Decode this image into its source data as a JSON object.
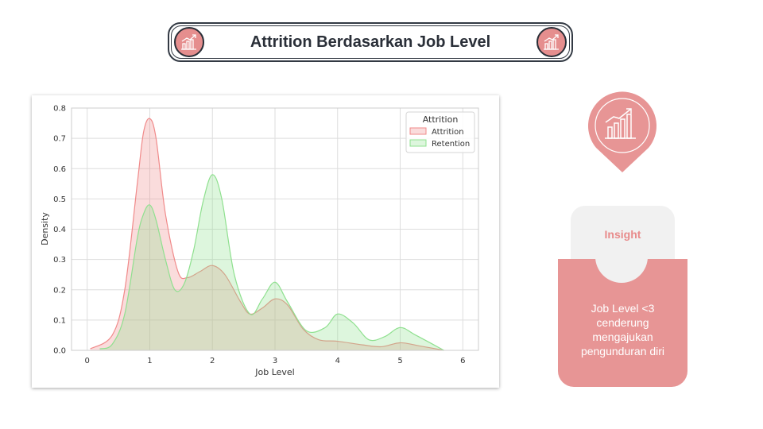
{
  "header": {
    "title": "Attrition Berdasarkan Job Level",
    "icon": "chart-growth-icon"
  },
  "insight": {
    "label": "Insight",
    "text": "Job Level <3 cenderung mengajukan pengunduran diri",
    "icon": "chart-growth-icon"
  },
  "colors": {
    "accent": "#e79595",
    "dark": "#2a2f38",
    "attrition": "#f08a8a",
    "retention": "#8fe08f"
  },
  "chart_data": {
    "type": "area",
    "xlabel": "Job Level",
    "ylabel": "Density",
    "xlim": [
      -0.25,
      6.25
    ],
    "ylim": [
      0,
      0.8
    ],
    "xticks": [
      0,
      1,
      2,
      3,
      4,
      5,
      6
    ],
    "yticks": [
      0.0,
      0.1,
      0.2,
      0.3,
      0.4,
      0.5,
      0.6,
      0.7,
      0.8
    ],
    "grid": true,
    "legend": {
      "title": "Attrition",
      "placement": "top-right"
    },
    "series": [
      {
        "name": "Attrition",
        "color": "#f08a8a",
        "x": [
          0.05,
          0.4,
          0.6,
          0.8,
          0.9,
          1.0,
          1.1,
          1.25,
          1.45,
          1.6,
          1.8,
          2.0,
          2.2,
          2.45,
          2.6,
          2.8,
          3.0,
          3.2,
          3.45,
          3.7,
          4.0,
          4.4,
          4.7,
          5.0,
          5.3,
          5.7
        ],
        "y": [
          0.005,
          0.05,
          0.2,
          0.55,
          0.72,
          0.765,
          0.7,
          0.45,
          0.26,
          0.24,
          0.26,
          0.28,
          0.25,
          0.16,
          0.12,
          0.14,
          0.17,
          0.15,
          0.07,
          0.035,
          0.03,
          0.018,
          0.012,
          0.025,
          0.015,
          0.0
        ]
      },
      {
        "name": "Retention",
        "color": "#8fe08f",
        "x": [
          0.2,
          0.4,
          0.6,
          0.8,
          0.9,
          1.0,
          1.1,
          1.25,
          1.4,
          1.55,
          1.7,
          1.85,
          2.0,
          2.15,
          2.35,
          2.6,
          2.8,
          3.0,
          3.2,
          3.5,
          3.8,
          4.0,
          4.25,
          4.5,
          4.75,
          5.0,
          5.25,
          5.7
        ],
        "y": [
          0.005,
          0.02,
          0.12,
          0.37,
          0.45,
          0.48,
          0.43,
          0.3,
          0.2,
          0.22,
          0.33,
          0.49,
          0.58,
          0.5,
          0.25,
          0.12,
          0.17,
          0.225,
          0.16,
          0.065,
          0.075,
          0.12,
          0.09,
          0.035,
          0.045,
          0.075,
          0.05,
          0.0
        ]
      }
    ]
  }
}
